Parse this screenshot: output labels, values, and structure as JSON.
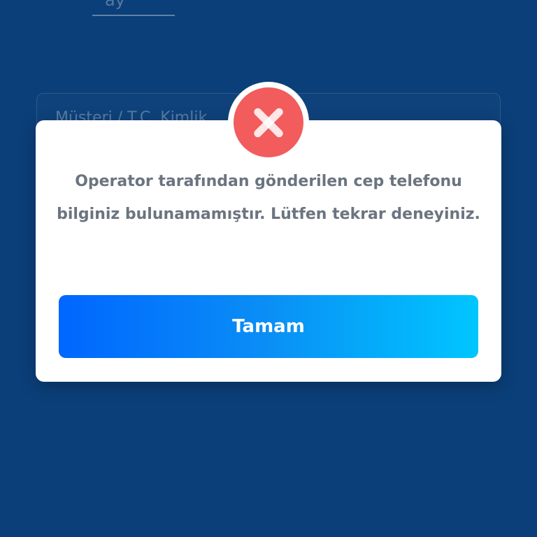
{
  "background": {
    "tab_text": "ay",
    "input_placeholder": "Müşteri / T.C. Kimlik"
  },
  "dialog": {
    "icon": "error-x-icon",
    "message": "Operator tarafından gönderilen cep telefonu bilginiz bulunamamıştır. Lütfen tekrar deneyiniz.",
    "button_label": "Tamam"
  },
  "colors": {
    "background": "#0b3f79",
    "error": "#f25c5c",
    "button_gradient_start": "#0066ff",
    "button_gradient_end": "#00c6ff",
    "message_text": "#6b7480"
  }
}
